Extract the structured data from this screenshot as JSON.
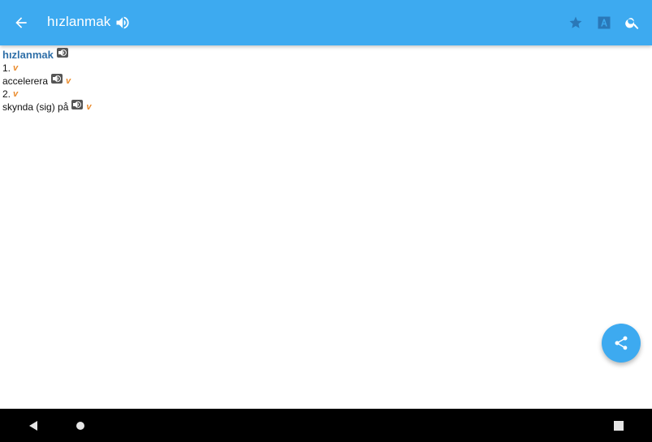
{
  "appbar": {
    "title": "hızlanmak",
    "icons": {
      "back": "arrow-back-icon",
      "speak": "speaker-icon",
      "favorite": "star-icon",
      "translate": "letter-a-icon",
      "search": "search-icon"
    },
    "color": "#3daaf0"
  },
  "entry": {
    "headword": "hızlanmak",
    "senses": [
      {
        "number": "1.",
        "pos": "v",
        "translation": "accelerera",
        "translation_pos": "v"
      },
      {
        "number": "2.",
        "pos": "v",
        "translation": "skynda (sig) på",
        "translation_pos": "v"
      }
    ],
    "colors": {
      "headword": "#2f6fa8",
      "pos": "#ea8a2a"
    }
  },
  "fab": {
    "icon": "share-icon"
  },
  "navbar": {
    "icons": [
      "nav-back-icon",
      "nav-home-icon",
      "nav-recent-icon"
    ]
  }
}
